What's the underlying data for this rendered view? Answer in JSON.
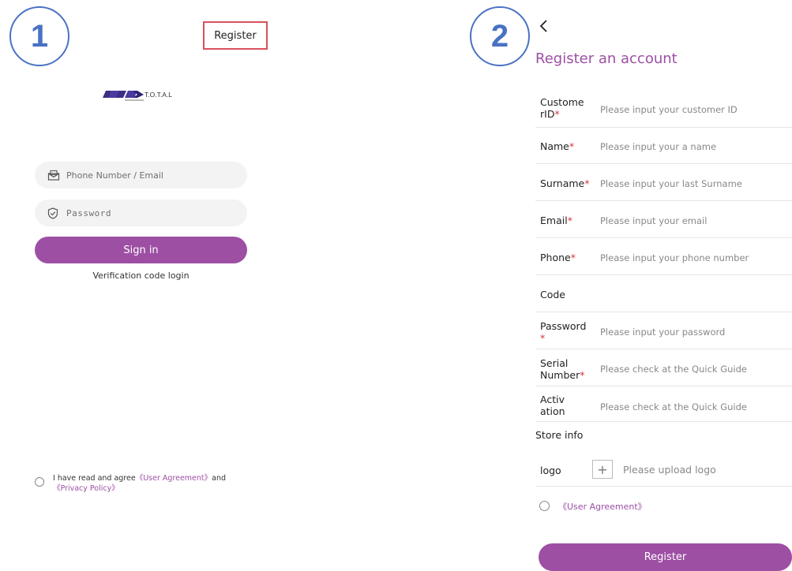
{
  "steps": {
    "one": "1",
    "two": "2"
  },
  "login": {
    "register_label": "Register",
    "logo_text": "T.O.T.A.L",
    "phone_placeholder": "Phone Number / Email",
    "password_placeholder": "Password",
    "signin_label": "Sign in",
    "verification_label": "Verification code login",
    "agree_prefix": "I have read and agree",
    "user_agreement": "《User Agreement》",
    "agree_and": "and",
    "privacy_policy": "《Privacy Policy》"
  },
  "register": {
    "title": "Register an account",
    "fields": [
      {
        "label": "Custome rID",
        "placeholder": "Please input your customer ID"
      },
      {
        "label": "Name",
        "placeholder": "Please input your a name"
      },
      {
        "label": "Surname",
        "placeholder": "Please input your last Surname"
      },
      {
        "label": "Email",
        "placeholder": "Please input your email"
      },
      {
        "label": "Phone",
        "placeholder": "Please input your phone number"
      },
      {
        "label": "Code",
        "placeholder": ""
      },
      {
        "label": "Password",
        "placeholder": "Please input your password"
      },
      {
        "label": "Serial Number",
        "placeholder": "Please check at the Quick Guide"
      },
      {
        "label": "Activ ation",
        "placeholder": "Please check at the Quick Guide"
      }
    ],
    "store_info": "Store info",
    "logo_label": "logo",
    "upload_placeholder": "Please upload logo",
    "user_agreement": "《User Agreement》",
    "register_button": "Register"
  },
  "colors": {
    "accent": "#9d4fa4",
    "required": "#d8343f",
    "badge": "#4a72c4",
    "highlight": "#d9505b"
  }
}
